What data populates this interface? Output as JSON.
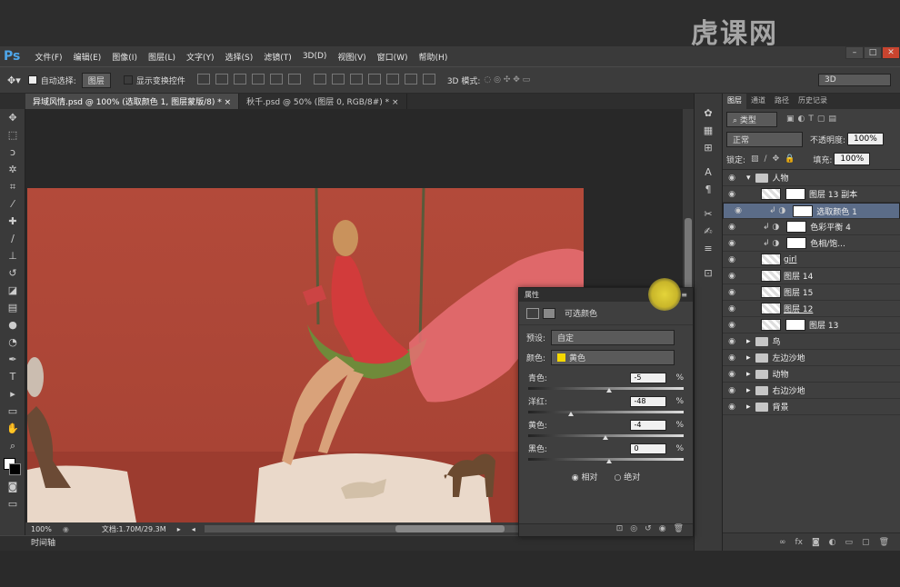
{
  "app": {
    "logo": "Ps",
    "watermark": "虎课网"
  },
  "menu": [
    "文件(F)",
    "编辑(E)",
    "图像(I)",
    "图层(L)",
    "文字(Y)",
    "选择(S)",
    "滤镜(T)",
    "3D(D)",
    "视图(V)",
    "窗口(W)",
    "帮助(H)"
  ],
  "options": {
    "auto_select_label": "自动选择:",
    "auto_select_value": "图层",
    "show_transform_label": "显示变换控件",
    "mode_3d_label": "3D 模式:",
    "workspace": "3D"
  },
  "tabs": [
    "异域风情.psd @ 100% (选取颜色 1, 图层蒙版/8) *",
    "秋千.psd @ 50% (图层 0, RGB/8#) *"
  ],
  "status": {
    "zoom": "100%",
    "doc": "文档:1.70M/29.3M"
  },
  "timeline": "时间轴",
  "layers_panel": {
    "tabs": [
      "图层",
      "通道",
      "路径",
      "历史记录"
    ],
    "filter_kind": "类型",
    "blend_mode": "正常",
    "opacity_label": "不透明度:",
    "opacity": "100%",
    "lock_label": "锁定:",
    "fill_label": "填充:",
    "fill": "100%",
    "layers": [
      {
        "name": "人物",
        "type": "group",
        "expanded": true,
        "indent": 0
      },
      {
        "name": "图层 13 副本",
        "type": "layer",
        "indent": 1
      },
      {
        "name": "选取颜色 1",
        "type": "adjust",
        "indent": 1,
        "selected": true
      },
      {
        "name": "色彩平衡 4",
        "type": "adjust",
        "indent": 1
      },
      {
        "name": "色相/饱...",
        "type": "adjust",
        "indent": 1
      },
      {
        "name": "girl",
        "type": "smart",
        "indent": 1
      },
      {
        "name": "图层 14",
        "type": "layer",
        "indent": 1
      },
      {
        "name": "图层 15",
        "type": "layer",
        "indent": 1
      },
      {
        "name": "图层 12",
        "type": "smart",
        "indent": 1
      },
      {
        "name": "图层 13",
        "type": "layer",
        "indent": 1
      },
      {
        "name": "鸟",
        "type": "group",
        "indent": 0
      },
      {
        "name": "左边沙地",
        "type": "group",
        "indent": 0
      },
      {
        "name": "动物",
        "type": "group",
        "indent": 0
      },
      {
        "name": "右边沙地",
        "type": "group",
        "indent": 0
      },
      {
        "name": "背景",
        "type": "group",
        "indent": 0
      }
    ]
  },
  "properties": {
    "title": "属性",
    "adjust_name": "可选颜色",
    "preset_label": "预设:",
    "preset_value": "自定",
    "color_label": "颜色:",
    "color_value": "黄色",
    "sliders": [
      {
        "label": "青色:",
        "value": "-5",
        "pct": "%"
      },
      {
        "label": "洋红:",
        "value": "-48",
        "pct": "%"
      },
      {
        "label": "黄色:",
        "value": "-4",
        "pct": "%"
      },
      {
        "label": "黑色:",
        "value": "0",
        "pct": "%"
      }
    ],
    "relative": "相对",
    "absolute": "绝对"
  },
  "colors": {
    "accent": "#f5d800",
    "selected_layer": "#5b6c88"
  }
}
